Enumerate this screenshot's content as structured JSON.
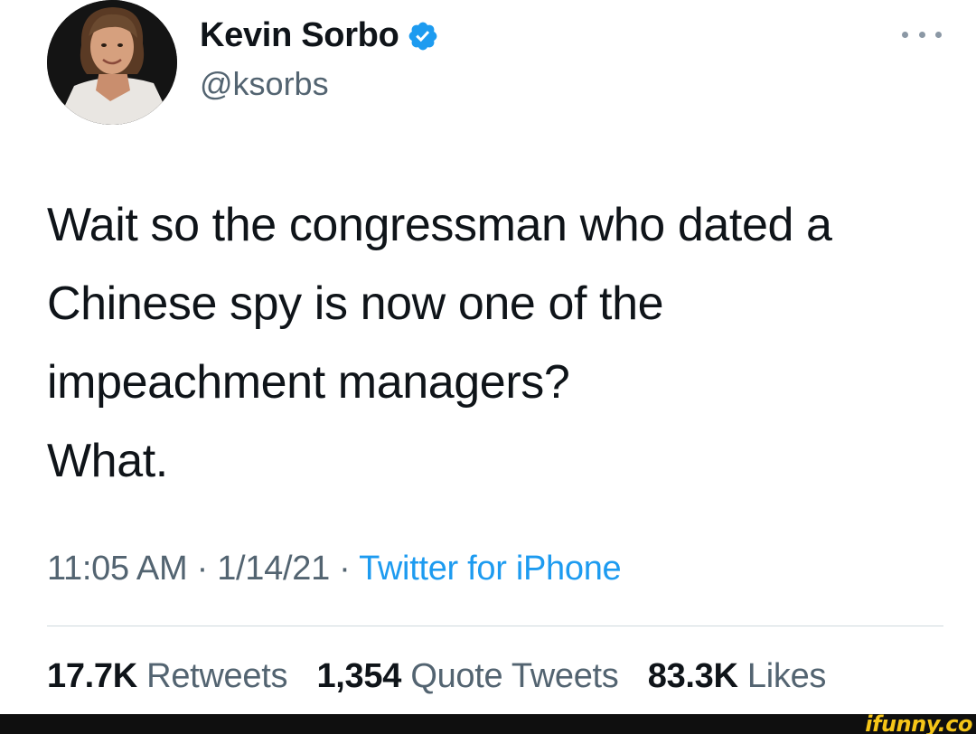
{
  "author": {
    "display_name": "Kevin Sorbo",
    "handle": "@ksorbs",
    "verified": true,
    "avatar_icon": "profile-photo"
  },
  "tweet": {
    "lines": [
      "Wait so the congressman who dated a",
      "Chinese spy is now one of the",
      "impeachment managers?",
      "What."
    ]
  },
  "meta": {
    "time": "11:05 AM",
    "separator": " · ",
    "date": "1/14/21",
    "source": "Twitter for iPhone"
  },
  "stats": {
    "retweets_count": "17.7K",
    "retweets_label": "Retweets",
    "quotes_count": "1,354",
    "quotes_label": "Quote Tweets",
    "likes_count": "83.3K",
    "likes_label": "Likes"
  },
  "watermark": {
    "text": "ifunny.co"
  },
  "colors": {
    "text_primary": "#0f1419",
    "text_secondary": "#536471",
    "link": "#1d9bf0",
    "verified": "#1d9bf0",
    "watermark": "#f5c518"
  }
}
